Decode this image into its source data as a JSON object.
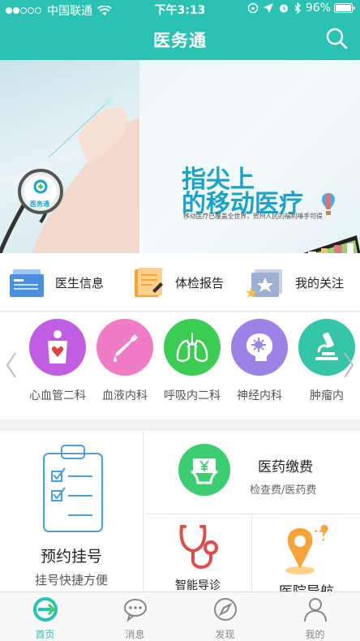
{
  "status_bar": {
    "carrier": "中国联通",
    "time": "下午3:13",
    "battery": "96%"
  },
  "navbar": {
    "title": "医务通"
  },
  "banner": {
    "headline_line1": "指尖上",
    "headline_line2": "的移动医疗",
    "slogan": "移动医疗已覆盖全世界，贺州人民的福利唾手可得",
    "logo_text": "医务通"
  },
  "quick_links": [
    {
      "label": "医生信息",
      "icon": "doctor-card-icon"
    },
    {
      "label": "体检报告",
      "icon": "report-icon"
    },
    {
      "label": "我的关注",
      "icon": "favorites-folder-icon"
    }
  ],
  "departments": [
    {
      "label": "心血管二科",
      "color": "#c15de0",
      "icon": "heart-body-icon"
    },
    {
      "label": "血液内科",
      "color": "#f07cc5",
      "icon": "dropper-icon"
    },
    {
      "label": "呼吸内二科",
      "color": "#3ccc53",
      "icon": "lungs-icon"
    },
    {
      "label": "神经内科",
      "color": "#9a82e6",
      "icon": "brain-icon"
    },
    {
      "label": "肿瘤内",
      "color": "#36c5a7",
      "icon": "microscope-icon"
    }
  ],
  "services": {
    "appointment": {
      "title": "预约挂号",
      "subtitle": "挂号快捷方便"
    },
    "payment": {
      "title": "医药缴费",
      "subtitle": "检查费/医药费"
    },
    "guide": {
      "title": "智能导诊"
    },
    "navigation": {
      "title": "医院导航"
    }
  },
  "tabbar": [
    {
      "label": "首页",
      "icon": "home-e-icon",
      "active": true
    },
    {
      "label": "消息",
      "icon": "message-icon",
      "active": false
    },
    {
      "label": "发现",
      "icon": "compass-icon",
      "active": false
    },
    {
      "label": "我的",
      "icon": "user-icon",
      "active": false
    }
  ],
  "colors": {
    "primary": "#2bc2b4",
    "headline": "#1aa2c9"
  }
}
